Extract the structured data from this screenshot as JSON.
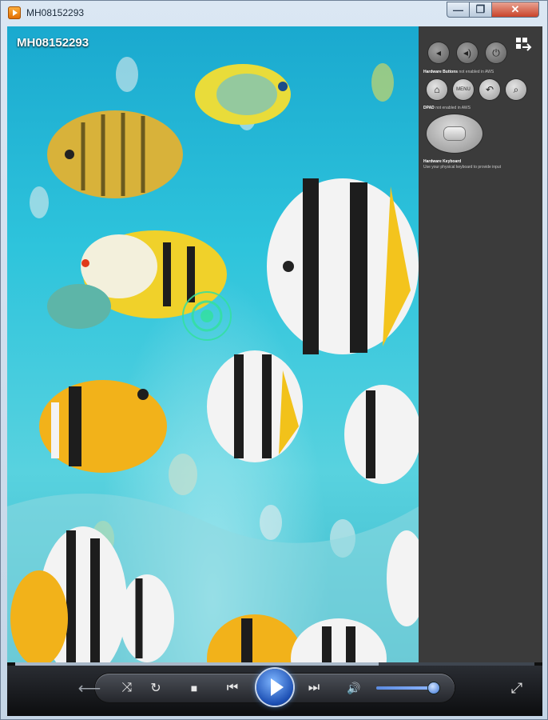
{
  "window": {
    "title": "MH08152293",
    "minimize_glyph": "—",
    "maximize_glyph": "❐",
    "close_glyph": "✕"
  },
  "video": {
    "label": "MH08152293",
    "content": "tropical-fish-aquarium"
  },
  "panel": {
    "top_icons": [
      "volume-down-icon",
      "volume-up-icon",
      "power-icon"
    ],
    "nav_icons": [
      "home-icon",
      "menu-icon",
      "back-icon",
      "search-icon"
    ],
    "menu_button_label": "MENU",
    "hardware_buttons_title": "Hardware Buttons",
    "hardware_buttons_note": "not enabled in AWS",
    "dpad_title": "DPAD",
    "dpad_note": "not enabled in AWS",
    "keyboard_title": "Hardware Keyboard",
    "keyboard_note": "Use your physical keyboard to provide input"
  },
  "player": {
    "seek_progress": 0.7,
    "volume_level": 0.9,
    "icons": [
      "back-arrow-icon",
      "shuffle-icon",
      "repeat-icon",
      "stop-icon",
      "previous-icon",
      "play-icon",
      "next-icon",
      "volume-icon",
      "switch-to-now-playing-icon"
    ],
    "back_glyph": "⟵",
    "shuffle_glyph": "⤨",
    "repeat_glyph": "↻",
    "stop_glyph": "■",
    "prev_glyph": "⏮",
    "next_glyph": "⏭",
    "volume_glyph": "🔊",
    "fullscreen_glyph": "⤢"
  },
  "colors": {
    "water": "#2ec4dc",
    "panel_bg": "#3b3b3b",
    "play_button": "#1c4fb3"
  }
}
